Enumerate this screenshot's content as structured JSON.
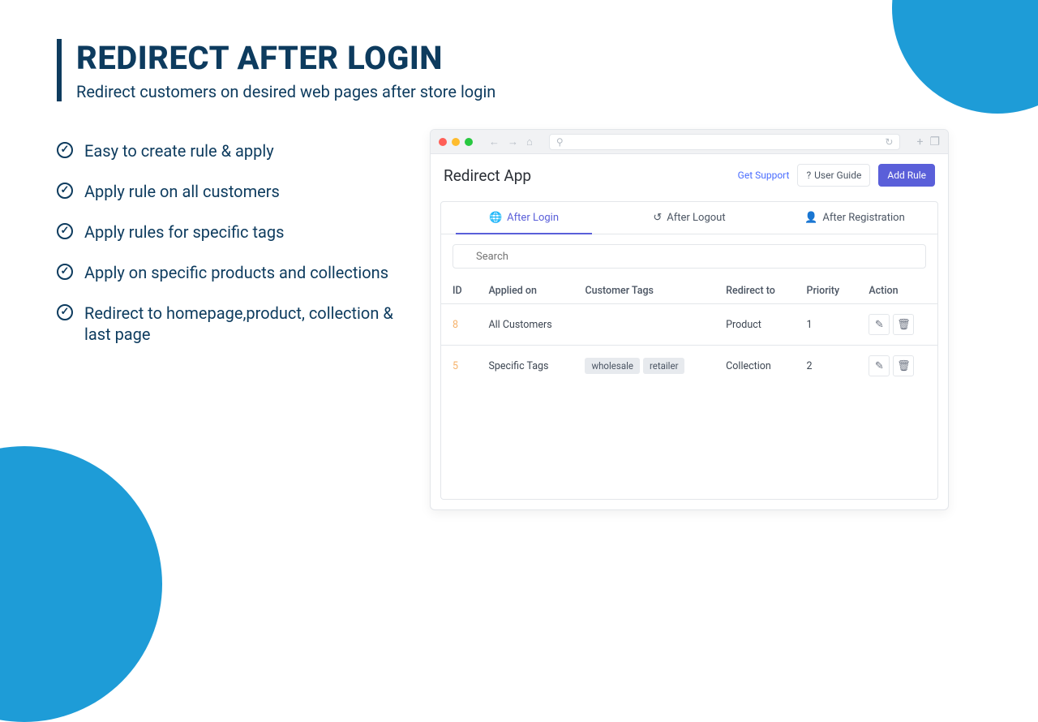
{
  "hero": {
    "title": "REDIRECT AFTER LOGIN",
    "subtitle": "Redirect customers on desired web pages after store login"
  },
  "bullets": [
    "Easy to create rule & apply",
    "Apply rule on all customers",
    "Apply rules for specific tags",
    "Apply on specific products and collections",
    "Redirect to homepage,product, collection & last page"
  ],
  "app": {
    "title": "Redirect App",
    "get_support": "Get Support",
    "user_guide": "User Guide",
    "add_rule": "Add Rule",
    "tabs": {
      "login": "After Login",
      "logout": "After Logout",
      "registration": "After Registration"
    },
    "search_placeholder": "Search",
    "columns": {
      "id": "ID",
      "applied_on": "Applied on",
      "tags": "Customer Tags",
      "redirect_to": "Redirect to",
      "priority": "Priority",
      "action": "Action"
    },
    "rows": [
      {
        "id": "8",
        "applied_on": "All Customers",
        "tags": [],
        "redirect_to": "Product",
        "priority": "1"
      },
      {
        "id": "5",
        "applied_on": "Specific Tags",
        "tags": [
          "wholesale",
          "retailer"
        ],
        "redirect_to": "Collection",
        "priority": "2"
      }
    ]
  }
}
